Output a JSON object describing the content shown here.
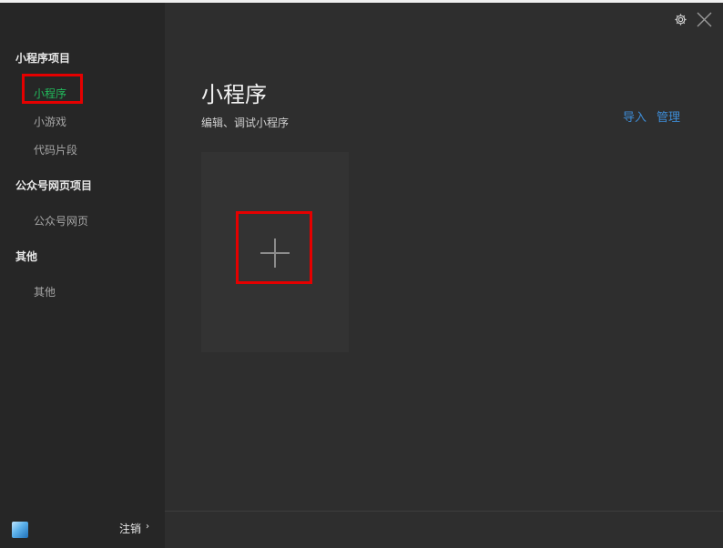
{
  "sidebar": {
    "sections": [
      {
        "title": "小程序项目",
        "items": [
          {
            "label": "小程序",
            "active": true
          },
          {
            "label": "小游戏"
          },
          {
            "label": "代码片段"
          }
        ]
      },
      {
        "title": "公众号网页项目",
        "items": [
          {
            "label": "公众号网页"
          }
        ]
      },
      {
        "title": "其他",
        "items": [
          {
            "label": "其他"
          }
        ]
      }
    ],
    "logout_label": "注销",
    "logout_chevron": "›"
  },
  "main": {
    "title": "小程序",
    "subtitle": "编辑、调试小程序",
    "links": {
      "import": "导入",
      "manage": "管理"
    }
  },
  "colors": {
    "accent_green": "#22b85b",
    "link_blue": "#3d8bd4",
    "highlight_red": "#e50000"
  },
  "icons": {
    "settings": "gear-icon",
    "close": "close-icon",
    "new_project": "plus-icon"
  }
}
